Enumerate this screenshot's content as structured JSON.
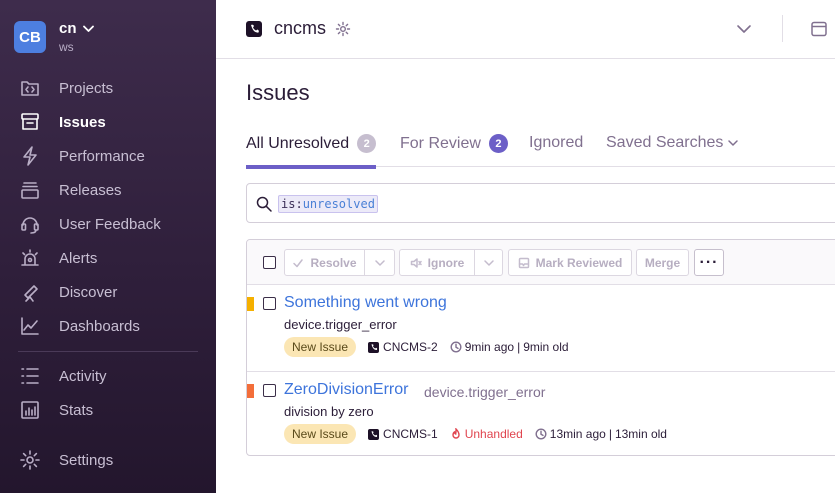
{
  "org": {
    "initials": "CB",
    "name": "cn",
    "user": "ws"
  },
  "sidebar": {
    "items": [
      {
        "label": "Projects",
        "icon": "projects-icon"
      },
      {
        "label": "Issues",
        "icon": "issues-icon",
        "active": true
      },
      {
        "label": "Performance",
        "icon": "performance-icon"
      },
      {
        "label": "Releases",
        "icon": "releases-icon"
      },
      {
        "label": "User Feedback",
        "icon": "user-feedback-icon"
      },
      {
        "label": "Alerts",
        "icon": "alerts-icon"
      },
      {
        "label": "Discover",
        "icon": "discover-icon"
      },
      {
        "label": "Dashboards",
        "icon": "dashboards-icon"
      },
      {
        "label": "Activity",
        "icon": "activity-icon"
      },
      {
        "label": "Stats",
        "icon": "stats-icon"
      },
      {
        "label": "Settings",
        "icon": "settings-icon"
      }
    ]
  },
  "header": {
    "project": "cncms"
  },
  "page": {
    "title": "Issues"
  },
  "tabs": [
    {
      "label": "All Unresolved",
      "count": "2",
      "active": true
    },
    {
      "label": "For Review",
      "count": "2"
    },
    {
      "label": "Ignored"
    },
    {
      "label": "Saved Searches"
    }
  ],
  "search": {
    "token_key": "is:",
    "token_value": "unresolved"
  },
  "toolbar": {
    "resolve": "Resolve",
    "ignore": "Ignore",
    "mark_reviewed": "Mark Reviewed",
    "merge": "Merge",
    "more": "···"
  },
  "issues": [
    {
      "title": "Something went wrong",
      "culprit": "",
      "message": "device.trigger_error",
      "tag": "New Issue",
      "short_id": "CNCMS-2",
      "handled": "",
      "last_seen": "9min ago",
      "age": "9min old",
      "level_color": "#f5b000"
    },
    {
      "title": "ZeroDivisionError",
      "culprit": "device.trigger_error",
      "message": "division by zero",
      "tag": "New Issue",
      "short_id": "CNCMS-1",
      "handled": "Unhandled",
      "last_seen": "13min ago",
      "age": "13min old",
      "level_color": "#f36e3a"
    }
  ],
  "colors": {
    "accent": "#6c5fc7",
    "link": "#3d74db",
    "sidebar": "#3e2c4c"
  }
}
